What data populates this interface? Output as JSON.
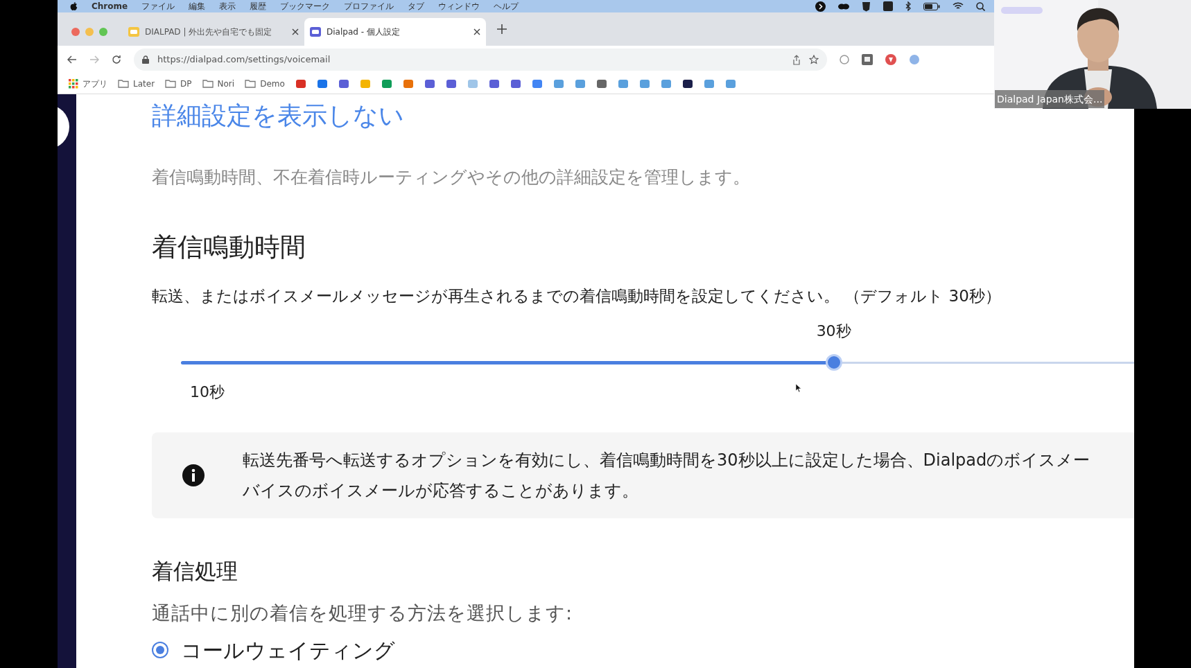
{
  "menu_bar": {
    "app": "Chrome",
    "items": [
      "ファイル",
      "編集",
      "表示",
      "履歴",
      "ブックマーク",
      "プロファイル",
      "タブ",
      "ウィンドウ",
      "ヘルプ"
    ]
  },
  "tabs": [
    {
      "title": "DIALPAD | 外出先や自宅でも固定",
      "selected": false
    },
    {
      "title": "Dialpad - 個人設定",
      "selected": true
    }
  ],
  "address_bar": {
    "url": "https://dialpad.com/settings/voicemail"
  },
  "bookmarks": [
    {
      "label": "アプリ",
      "kind": "apps"
    },
    {
      "label": "Later",
      "kind": "folder"
    },
    {
      "label": "DP",
      "kind": "folder"
    },
    {
      "label": "Nori",
      "kind": "folder"
    },
    {
      "label": "Demo",
      "kind": "folder"
    }
  ],
  "settings": {
    "toggle_link": "詳細設定を表示しない",
    "description": "着信鳴動時間、不在着信時ルーティングやその他の詳細設定を管理します。",
    "ring_duration": {
      "heading": "着信鳴動時間",
      "instruction": "転送、またはボイスメールメッセージが再生されるまでの着信鳴動時間を設定してください。 （デフォルト 30秒）",
      "slider": {
        "value_label": "30秒",
        "min_label": "10秒",
        "level": 0.675
      }
    },
    "info_note": {
      "lines": [
        "転送先番号へ転送するオプションを有効にし、着信鳴動時間を30秒以上に設定した場合、Dialpadのボイスメー",
        "バイスのボイスメールが応答することがあります。"
      ]
    },
    "call_handling": {
      "heading": "着信処理",
      "prompt": "通話中に別の着信を処理する方法を選択します:",
      "options": [
        {
          "label": "コールウェイティング",
          "selected": true
        }
      ]
    }
  },
  "video_overlay": {
    "name_label": "Dialpad Japan株式会..."
  }
}
